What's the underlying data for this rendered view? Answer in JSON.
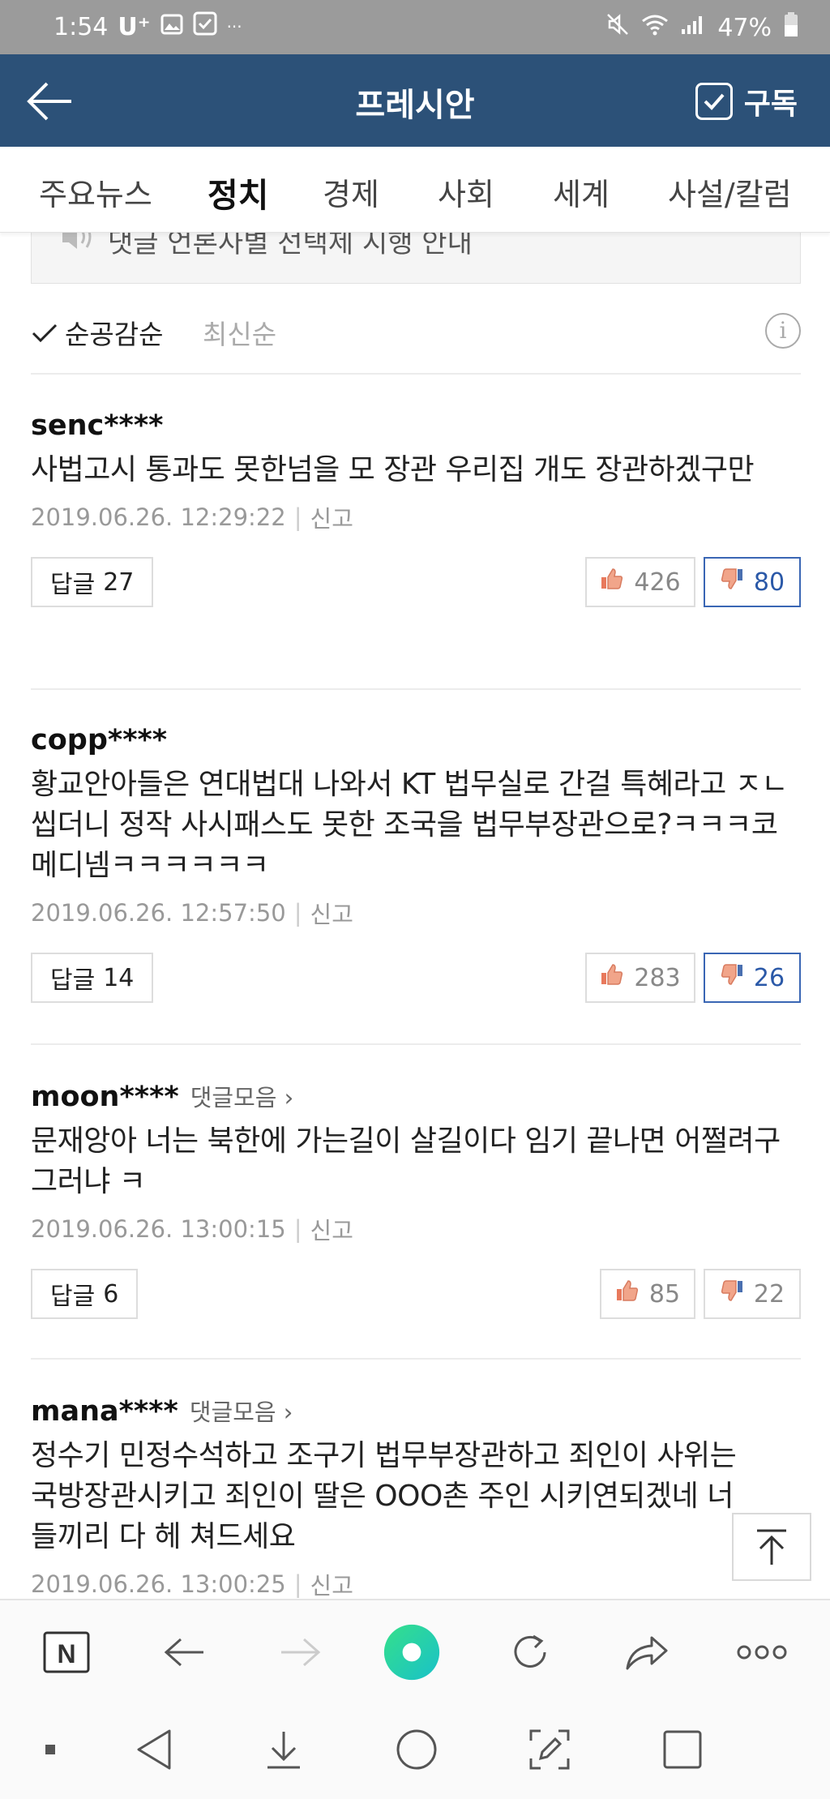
{
  "status_bar": {
    "time": "1:54",
    "carrier": "U⁺",
    "more": "···",
    "battery": "47%"
  },
  "app_bar": {
    "title": "프레시안",
    "subscribe_label": "구독"
  },
  "tabs": [
    {
      "label": "주요뉴스"
    },
    {
      "label": "정치",
      "active": true
    },
    {
      "label": "경제"
    },
    {
      "label": "사회"
    },
    {
      "label": "세계"
    },
    {
      "label": "사설/칼럼"
    }
  ],
  "notice": {
    "text": "댓글 언론사별 선택제 시행 안내"
  },
  "sort": {
    "active": "순공감순",
    "inactive": "최신순"
  },
  "comments": [
    {
      "user": "senc****",
      "collect": "",
      "text": "사법고시 통과도 못한넘을 모 장관 우리집 개도 장관하겠구만",
      "date": "2019.06.26. 12:29:22",
      "report": "신고",
      "reply_label": "답글",
      "reply_count": "27",
      "likes": "426",
      "dislikes": "80"
    },
    {
      "user": "copp****",
      "collect": "",
      "text": "황교안아들은 연대법대 나와서 KT 법무실로 간걸 특혜라고 ㅈㄴ 씹더니 정작 사시패스도 못한 조국을 법무부장관으로?ㅋㅋㅋ코메디넴ㅋㅋㅋㅋㅋㅋ",
      "date": "2019.06.26. 12:57:50",
      "report": "신고",
      "reply_label": "답글",
      "reply_count": "14",
      "likes": "283",
      "dislikes": "26"
    },
    {
      "user": "moon****",
      "collect": "댓글모음 ›",
      "text": "문재앙아 너는 북한에 가는길이 살길이다 임기 끝나면 어쩔려구 그러냐 ㅋ",
      "date": "2019.06.26. 13:00:15",
      "report": "신고",
      "reply_label": "답글",
      "reply_count": "6",
      "likes": "85",
      "dislikes": "22"
    },
    {
      "user": "mana****",
      "collect": "댓글모음 ›",
      "text": "정수기 민정수석하고 조구기 법무부장관하고 죄인이 사위는 국방장관시키고 죄인이 딸은 OOO촌 주인 시키연되겠네 너들끼리 다 헤 쳐드세요",
      "date": "2019.06.26. 13:00:25",
      "report": "신고"
    }
  ],
  "browser_bar": {
    "icons": [
      "naver-home-icon",
      "back-arrow-icon",
      "forward-arrow-icon",
      "green-dot-icon",
      "refresh-icon",
      "share-icon",
      "more-icon"
    ],
    "home_letter": "N",
    "more_glyph": "ooo"
  },
  "colors": {
    "header_bg": "#2c5178",
    "status_bg": "#9b9b9b",
    "selected_dislike": "#2b59a8"
  }
}
